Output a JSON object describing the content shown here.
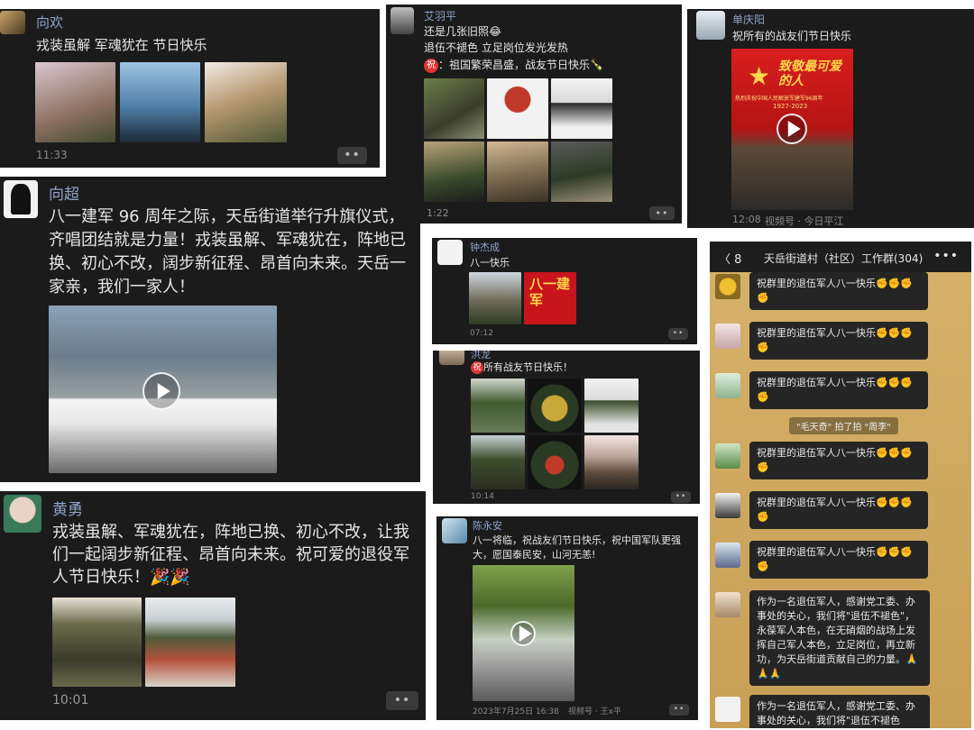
{
  "post1": {
    "name": "向欢",
    "text": "戎装虽解 军魂犹在 节日快乐",
    "time": "11:33",
    "more": "••"
  },
  "post2": {
    "name": "艾羽平",
    "line1": "还是几张旧照😂",
    "line2": "退伍不褪色 立足岗位发光发热",
    "badge": "祝",
    "line3": "：祖国繁荣昌盛，战友节日快乐🍾",
    "time": "1:22",
    "more": "••"
  },
  "post3": {
    "name": "单庆阳",
    "text": "祝所有的战友们节日快乐",
    "poster_title": "致敬最可爱的人",
    "poster_sub": "热烈庆祝中国人民解放军建军96周年",
    "poster_years": "1927-2023",
    "time": "12:08",
    "channel": "视频号 · 今日平江"
  },
  "post4": {
    "name": "向超",
    "text": "八一建军 96 周年之际，天岳街道举行升旗仪式，齐唱团结就是力量！戎装虽解、军魂犹在，阵地已换、初心不改，阔步新征程、昂首向未来。天岳一家亲，我们一家人！"
  },
  "post5": {
    "name": "钟杰成",
    "text": "八一快乐",
    "poster_text": "八一建军",
    "time": "07:12",
    "more": "••"
  },
  "post6": {
    "name": "洪龙",
    "badge": "祝",
    "text": "所有战友节日快乐！",
    "time": "10:14",
    "more": "••"
  },
  "post7": {
    "name": "黄勇",
    "text": "戎装虽解、军魂犹在，阵地已换、初心不改，让我们一起阔步新征程、昂首向未来。祝可爱的退役军人节日快乐！🎉🎉",
    "time": "10:01",
    "more": "••"
  },
  "post8": {
    "name": "陈永安",
    "text": "八一将临，祝战友们节日快乐，祝中国军队更强大，愿国泰民安，山河无恙!",
    "datetime": "2023年7月25日 16:38",
    "channel": "视频号 · 王x平",
    "more": "••"
  },
  "chat": {
    "back": "〈 8",
    "title": "天岳街道村（社区）工作群(304)",
    "dots": "•••",
    "greeting": "祝群里的退伍军人八一快乐✊✊✊✊",
    "system": "\"毛天奇\" 拍了拍 \"周李\"",
    "long_msg": "作为一名退伍军人，感谢党工委、办事处的关心，我们将\"退伍不褪色\"，永葆军人本色，在无硝烟的战场上发挥自己军人本色，立足岗位，再立新功，为天岳街道贡献自己的力量。🙏🙏🙏",
    "partial_msg": "作为一名退伍军人，感谢党工委、办事处的关心，我们将\"退伍不褪色"
  },
  "colors": {
    "card_bg": "#1b1b1b",
    "name": "#8fa3c8",
    "chat_bg": "#c89f55"
  }
}
